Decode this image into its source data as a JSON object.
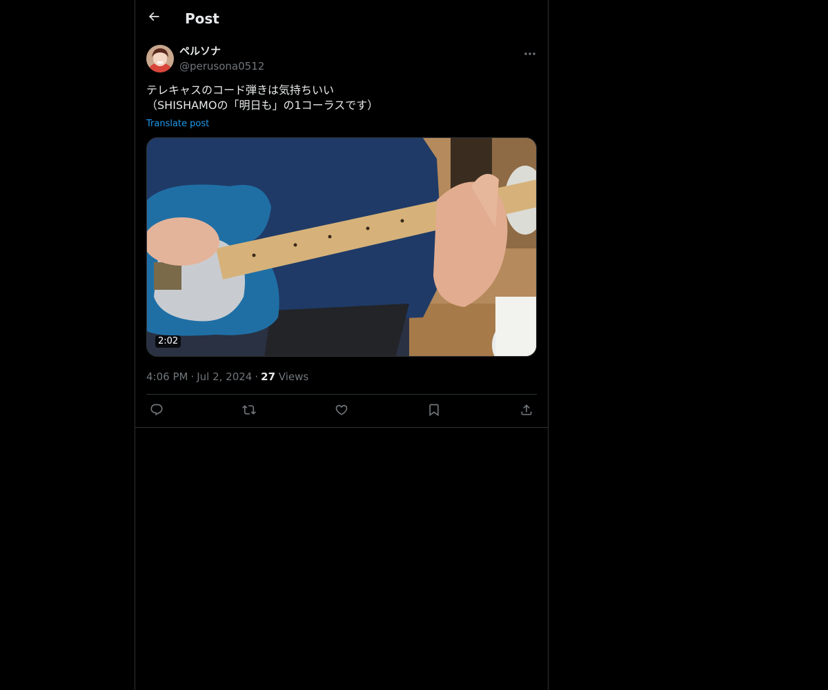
{
  "header": {
    "title": "Post",
    "back_icon": "arrow-left-icon"
  },
  "author": {
    "display_name": "ペルソナ",
    "handle": "@perusona0512"
  },
  "post": {
    "text_line1": "テレキャスのコード弾きは気持ちいい",
    "text_line2": "（SHISHAMOの「明日も」の1コーラスです）",
    "translate_label": "Translate post",
    "video_duration": "2:02"
  },
  "meta": {
    "time": "4:06 PM",
    "date": "Jul 2, 2024",
    "views_count": "27",
    "views_label": "Views",
    "separator": "·"
  },
  "actions": {
    "reply_icon": "reply-icon",
    "repost_icon": "repost-icon",
    "like_icon": "heart-icon",
    "bookmark_icon": "bookmark-icon",
    "share_icon": "share-icon"
  },
  "colors": {
    "background": "#000000",
    "text_primary": "#e7e9ea",
    "text_secondary": "#71767b",
    "accent": "#1d9bf0",
    "border": "#2f3336"
  }
}
